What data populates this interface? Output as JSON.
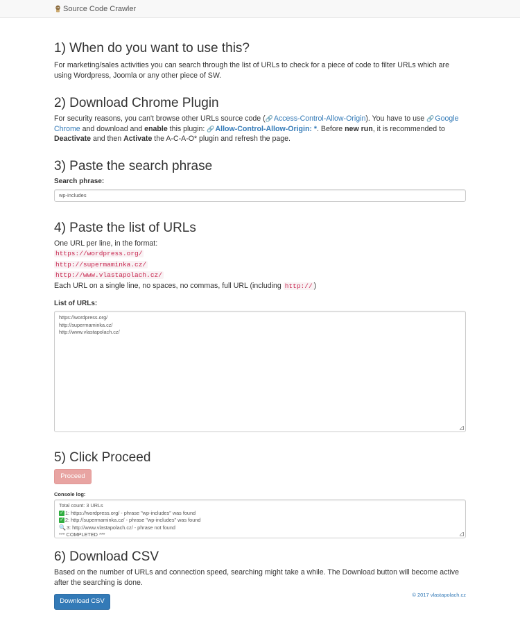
{
  "navbar": {
    "brand": "Source Code Crawler"
  },
  "s1": {
    "title": "1) When do you want to use this?",
    "text": "For marketing/sales activities you can search through the list of URLs to check for a piece of code to filter URLs which are using Wordpress, Joomla or any other piece of SW."
  },
  "s2": {
    "title": "2) Download Chrome Plugin",
    "t1": "For security reasons, you can't browse other URLs source code (",
    "link_acao": "Access-Control-Allow-Origin",
    "t2": "). You have to use ",
    "link_chrome": "Google Chrome",
    "t3": " and download and ",
    "b_enable": "enable",
    "t4": " this plugin: ",
    "link_plugin": "Allow-Control-Allow-Origin: *",
    "t5": ". Before ",
    "b_newrun": "new run",
    "t6": ", it is recommended to ",
    "b_deactivate": "Deactivate",
    "t7": " and then ",
    "b_activate": "Activate",
    "t8": " the A-C-A-O* plugin and refresh the page."
  },
  "s3": {
    "title": "3) Paste the search phrase",
    "label": "Search phrase:",
    "value": "wp-includes"
  },
  "s4": {
    "title": "4) Paste the list of URLs",
    "intro": "One URL per line, in the format:",
    "examples": [
      "https://wordpress.org/",
      "http://supermaminka.cz/",
      "http://www.vlastapolach.cz/"
    ],
    "note1": "Each URL on a single line, no spaces, no commas, full URL (including ",
    "note_code": "http://",
    "note2": ")",
    "label": "List of URLs:",
    "urls": [
      "https://wordpress.org/",
      "http://supermaminka.cz/",
      "http://www.vlastapolach.cz/"
    ]
  },
  "s5": {
    "title": "5) Click Proceed",
    "button": "Proceed",
    "console_label": "Console log:",
    "log": [
      "Total count: 3 URLs",
      "1: https://wordpress.org/ - phrase \"wp-includes\" was found",
      "2: http://supermaminka.cz/ - phrase \"wp-includes\" was found",
      "3: http://www.vlastapolach.cz/ - phrase not found",
      "*** COMPLETED ***"
    ]
  },
  "s6": {
    "title": "6) Download CSV",
    "text": "Based on the number of URLs and connection speed, searching might take a while. The Download button will become active after the searching is done.",
    "button": "Download CSV"
  },
  "footer": {
    "link": "© 2017 vlastapolach.cz"
  },
  "icons": {
    "brand": "app-logo-icon",
    "link": "link-icon",
    "check": "check-icon",
    "magnifier": "magnifier-icon"
  },
  "colors": {
    "link": "#337ab7",
    "code": "#c7254e",
    "proceed": "#e8a4a2",
    "primary": "#337ab7",
    "check": "#2fae3f"
  }
}
